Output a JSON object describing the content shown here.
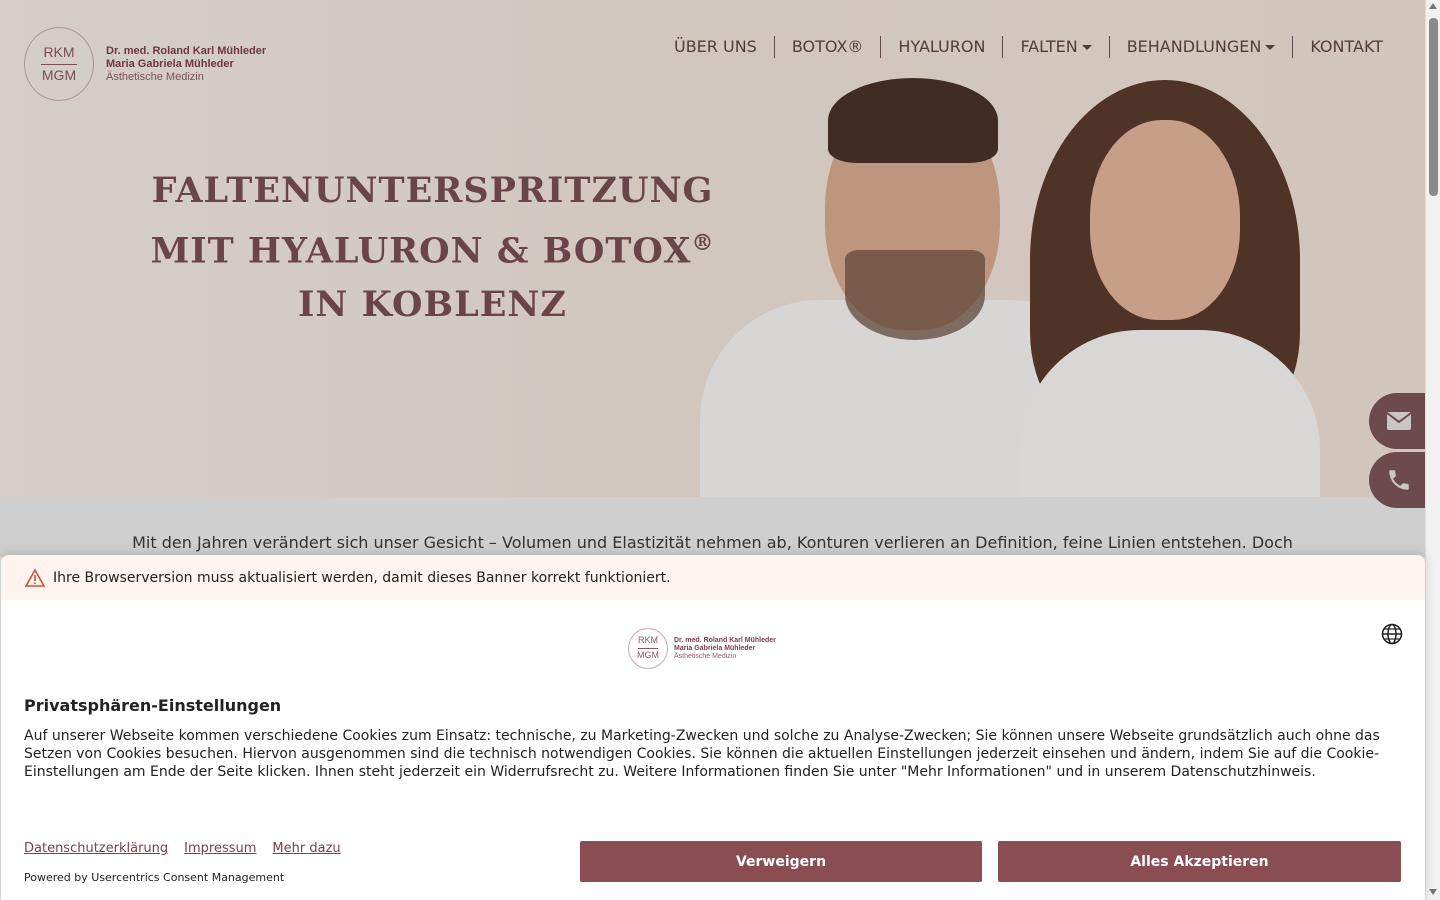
{
  "logo": {
    "mark_top": "RKM",
    "mark_bottom": "MGM",
    "line1": "Dr. med. Roland Karl Mühleder",
    "line2": "Maria Gabriela Mühleder",
    "line3": "Ästhetische Medizin"
  },
  "nav": {
    "items": [
      {
        "label": "ÜBER UNS"
      },
      {
        "label": "BOTOX®"
      },
      {
        "label": "HYALURON"
      },
      {
        "label": "FALTEN"
      },
      {
        "label": "BEHANDLUNGEN"
      },
      {
        "label": "KONTAKT"
      }
    ]
  },
  "hero": {
    "title_line1": "FALTENUNTERSPRITZUNG",
    "title_line2": "MIT HYALURON & BOTOX",
    "title_reg": "®",
    "title_line3": "IN KOBLENZ"
  },
  "intro": {
    "text": "Mit den Jahren verändert sich unser Gesicht – Volumen und Elastizität nehmen ab, Konturen verlieren an Definition, feine Linien entstehen. Doch"
  },
  "side_buttons": {
    "mail_icon": "envelope-icon",
    "phone_icon": "phone-icon"
  },
  "consent": {
    "warning": "Ihre Browserversion muss aktualisiert werden, damit dieses Banner korrekt funktioniert.",
    "title": "Privatsphären-Einstellungen",
    "body": "Auf unserer Webseite kommen verschiedene Cookies zum Einsatz: technische, zu Marketing-Zwecken und solche zu Analyse-Zwecken; Sie können unsere Webseite grundsätzlich auch ohne das Setzen von Cookies besuchen. Hiervon ausgenommen sind die technisch notwendigen Cookies. Sie können die aktuellen Einstellungen jederzeit einsehen und ändern, indem Sie auf die Cookie-Einstellungen am Ende der Seite klicken. Ihnen steht jederzeit ein Widerrufsrecht zu. Weitere Informationen finden Sie unter \"Mehr Informationen\" und in unserem Datenschutzhinweis.",
    "links": [
      {
        "label": "Datenschutzerklärung"
      },
      {
        "label": "Impressum"
      },
      {
        "label": "Mehr dazu"
      }
    ],
    "powered_by": "Powered by Usercentrics Consent Management",
    "deny_label": "Verweigern",
    "accept_label": "Alles Akzeptieren"
  },
  "colors": {
    "brand": "#8a4e52",
    "hero_text": "#7a4e55",
    "warning_bg": "#fdf3ef"
  }
}
